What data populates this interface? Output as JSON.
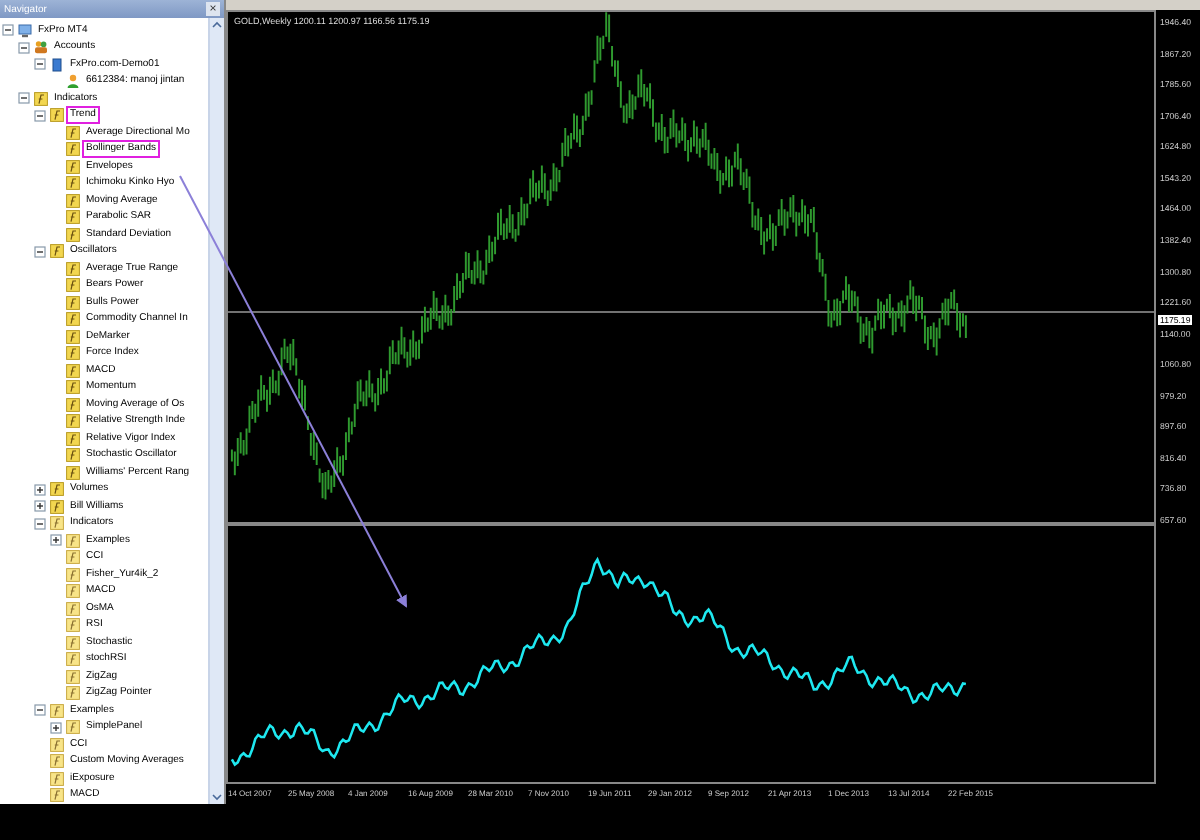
{
  "navigator": {
    "title": "Navigator",
    "close": "×",
    "tree": [
      {
        "label": "FxPro MT4",
        "kind": "terminal",
        "expanded": true,
        "children": [
          {
            "label": "Accounts",
            "kind": "accounts",
            "expanded": true,
            "children": [
              {
                "label": "FxPro.com-Demo01",
                "kind": "server",
                "expanded": true,
                "children": [
                  {
                    "label": "6612384: manoj jintan",
                    "kind": "user"
                  }
                ]
              }
            ]
          },
          {
            "label": "Indicators",
            "kind": "builtin",
            "expanded": true,
            "children": [
              {
                "label": "Trend",
                "kind": "builtin",
                "expanded": true,
                "marked": true,
                "children": [
                  {
                    "label": "Average Directional Mo",
                    "kind": "builtin"
                  },
                  {
                    "label": "Bollinger Bands",
                    "kind": "builtin",
                    "marked": true
                  },
                  {
                    "label": "Envelopes",
                    "kind": "builtin"
                  },
                  {
                    "label": "Ichimoku Kinko Hyo",
                    "kind": "builtin"
                  },
                  {
                    "label": "Moving Average",
                    "kind": "builtin"
                  },
                  {
                    "label": "Parabolic SAR",
                    "kind": "builtin"
                  },
                  {
                    "label": "Standard Deviation",
                    "kind": "builtin"
                  }
                ]
              },
              {
                "label": "Oscillators",
                "kind": "builtin",
                "expanded": true,
                "children": [
                  {
                    "label": "Average True Range",
                    "kind": "builtin"
                  },
                  {
                    "label": "Bears Power",
                    "kind": "builtin"
                  },
                  {
                    "label": "Bulls Power",
                    "kind": "builtin"
                  },
                  {
                    "label": "Commodity Channel In",
                    "kind": "builtin"
                  },
                  {
                    "label": "DeMarker",
                    "kind": "builtin"
                  },
                  {
                    "label": "Force Index",
                    "kind": "builtin"
                  },
                  {
                    "label": "MACD",
                    "kind": "builtin"
                  },
                  {
                    "label": "Momentum",
                    "kind": "builtin"
                  },
                  {
                    "label": "Moving Average of Os",
                    "kind": "builtin"
                  },
                  {
                    "label": "Relative Strength Inde",
                    "kind": "builtin"
                  },
                  {
                    "label": "Relative Vigor Index",
                    "kind": "builtin"
                  },
                  {
                    "label": "Stochastic Oscillator",
                    "kind": "builtin"
                  },
                  {
                    "label": "Williams' Percent Rang",
                    "kind": "builtin"
                  }
                ]
              },
              {
                "label": "Volumes",
                "kind": "builtin",
                "expanded": false
              },
              {
                "label": "Bill Williams",
                "kind": "builtin",
                "expanded": false
              },
              {
                "label": "Indicators",
                "kind": "custom",
                "expanded": true,
                "children": [
                  {
                    "label": "Examples",
                    "kind": "custom",
                    "expanded": false
                  },
                  {
                    "label": "CCI",
                    "kind": "custom"
                  },
                  {
                    "label": "Fisher_Yur4ik_2",
                    "kind": "custom"
                  },
                  {
                    "label": "MACD",
                    "kind": "custom"
                  },
                  {
                    "label": "OsMA",
                    "kind": "custom"
                  },
                  {
                    "label": "RSI",
                    "kind": "custom"
                  },
                  {
                    "label": "Stochastic",
                    "kind": "custom"
                  },
                  {
                    "label": "stochRSI",
                    "kind": "custom"
                  },
                  {
                    "label": "ZigZag",
                    "kind": "custom"
                  },
                  {
                    "label": "ZigZag Pointer",
                    "kind": "custom"
                  }
                ]
              },
              {
                "label": "Examples",
                "kind": "custom",
                "expanded": true,
                "children": [
                  {
                    "label": "SimplePanel",
                    "kind": "custom",
                    "expanded": false
                  }
                ]
              },
              {
                "label": "CCI",
                "kind": "custom"
              },
              {
                "label": "Custom Moving Averages",
                "kind": "custom"
              },
              {
                "label": "iExposure",
                "kind": "custom"
              },
              {
                "label": "MACD",
                "kind": "custom"
              }
            ]
          }
        ]
      }
    ]
  },
  "chart": {
    "symbol_info": "GOLD,Weekly  1200.11 1200.97 1166.56 1175.19",
    "price_labels": [
      "1946.40",
      "1867.20",
      "1785.60",
      "1706.40",
      "1624.80",
      "1543.20",
      "1464.00",
      "1382.40",
      "1300.80",
      "1221.60",
      "1140.00",
      "1060.80",
      "979.20",
      "897.60",
      "816.40",
      "736.80",
      "657.60"
    ],
    "current_price": "1175.19",
    "time_labels": [
      "14 Oct 2007",
      "25 May 2008",
      "4 Jan 2009",
      "16 Aug 2009",
      "28 Mar 2010",
      "7 Nov 2010",
      "19 Jun 2011",
      "29 Jan 2012",
      "9 Sep 2012",
      "21 Apr 2013",
      "1 Dec 2013",
      "13 Jul 2014",
      "22 Feb 2015"
    ]
  }
}
